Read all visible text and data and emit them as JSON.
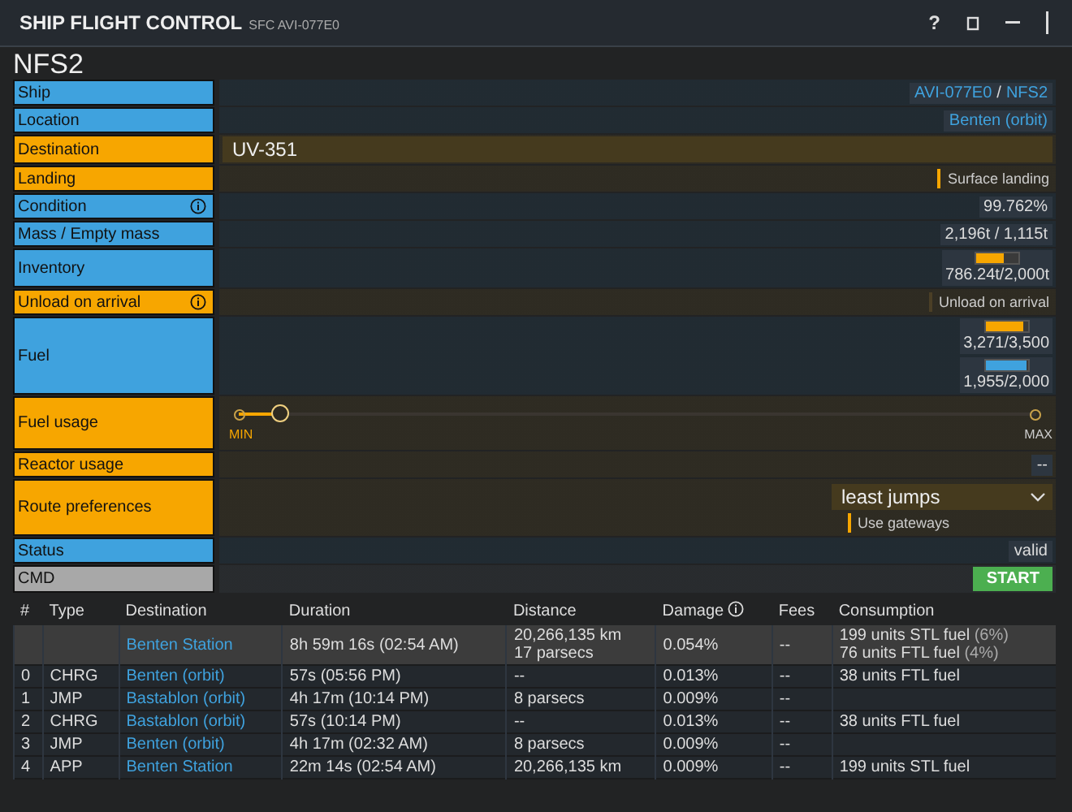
{
  "window": {
    "title": "SHIP FLIGHT CONTROL",
    "subtitle": "SFC AVI-077E0",
    "help": "?"
  },
  "form": {
    "heading": "NFS2",
    "rows": [
      {
        "label": "Ship",
        "color": "#3fa2de",
        "info": false,
        "kind": "links",
        "parts": [
          {
            "text": "AVI-077E0",
            "link": true
          },
          {
            "text": "/",
            "link": false
          },
          {
            "text": "NFS2",
            "link": true
          }
        ]
      },
      {
        "label": "Location",
        "color": "#3fa2de",
        "info": false,
        "kind": "links",
        "parts": [
          {
            "text": "Benten (orbit)",
            "link": true
          }
        ]
      },
      {
        "label": "Destination",
        "color": "#f7a600",
        "info": false,
        "kind": "input",
        "value": "UV-351"
      },
      {
        "label": "Landing",
        "color": "#f7a600",
        "info": false,
        "kind": "toggle",
        "text": "Surface landing",
        "on": true
      },
      {
        "label": "Condition",
        "color": "#3fa2de",
        "info": true,
        "kind": "text",
        "value": "99.762%"
      },
      {
        "label": "Mass / Empty mass",
        "color": "#3fa2de",
        "info": false,
        "kind": "text",
        "value": "2,196t / 1,115t"
      },
      {
        "label": "Inventory",
        "color": "#3fa2de",
        "info": false,
        "kind": "meters",
        "meters": [
          {
            "level": 0.65,
            "color": "#f7a600",
            "reading": "786.24t/2,000t"
          }
        ]
      },
      {
        "label": "Unload on arrival",
        "color": "#f7a600",
        "info": true,
        "kind": "toggle",
        "text": "Unload on arrival",
        "on": false
      },
      {
        "label": "Fuel",
        "color": "#3fa2de",
        "info": false,
        "kind": "meters",
        "meters": [
          {
            "level": 0.92,
            "color": "#f7a600",
            "reading": "3,271/3,500"
          },
          {
            "level": 0.98,
            "color": "#3fa2de",
            "reading": "1,955/2,000"
          }
        ]
      },
      {
        "label": "Fuel usage",
        "color": "#f7a600",
        "info": false,
        "kind": "slider",
        "level": 0.05,
        "min": "MIN",
        "max": "MAX"
      },
      {
        "label": "Reactor usage",
        "color": "#f7a600",
        "info": false,
        "kind": "text",
        "value": "--"
      },
      {
        "label": "Route preferences",
        "color": "#f7a600",
        "info": false,
        "kind": "dropdown",
        "value": "least jumps",
        "option": {
          "text": "Use gateways",
          "on": true
        }
      },
      {
        "label": "Status",
        "color": "#3fa2de",
        "info": false,
        "kind": "text",
        "value": "valid"
      },
      {
        "label": "CMD",
        "color": "#a8a8a8",
        "info": false,
        "kind": "button",
        "button": "START"
      }
    ]
  },
  "table": {
    "columns": [
      {
        "label": "#",
        "info": false
      },
      {
        "label": "Type",
        "info": false
      },
      {
        "label": "Destination",
        "info": false
      },
      {
        "label": "Duration",
        "info": false
      },
      {
        "label": "Distance",
        "info": false
      },
      {
        "label": "Damage",
        "info": true
      },
      {
        "label": "Fees",
        "info": false
      },
      {
        "label": "Consumption",
        "info": false
      }
    ],
    "rows": [
      {
        "selected": true,
        "number": "",
        "type": "",
        "destination": "Benten Station",
        "duration": "8h 59m 16s (02:54 AM)",
        "distance": [
          "20,266,135 km",
          "17 parsecs"
        ],
        "damage": "0.054%",
        "fees": "--",
        "consumption": [
          {
            "text": "199 units STL fuel",
            "note": "(6%)"
          },
          {
            "text": "76 units FTL fuel",
            "note": "(4%)"
          }
        ]
      },
      {
        "selected": false,
        "number": "0",
        "type": "CHRG",
        "destination": "Benten (orbit)",
        "duration": "57s (05:56 PM)",
        "distance": [
          "--"
        ],
        "damage": "0.013%",
        "fees": "--",
        "consumption": [
          {
            "text": "38 units FTL fuel"
          }
        ]
      },
      {
        "selected": false,
        "number": "1",
        "type": "JMP",
        "destination": "Bastablon (orbit)",
        "duration": "4h 17m (10:14 PM)",
        "distance": [
          "8 parsecs"
        ],
        "damage": "0.009%",
        "fees": "--",
        "consumption": []
      },
      {
        "selected": false,
        "number": "2",
        "type": "CHRG",
        "destination": "Bastablon (orbit)",
        "duration": "57s (10:14 PM)",
        "distance": [
          "--"
        ],
        "damage": "0.013%",
        "fees": "--",
        "consumption": [
          {
            "text": "38 units FTL fuel"
          }
        ]
      },
      {
        "selected": false,
        "number": "3",
        "type": "JMP",
        "destination": "Benten (orbit)",
        "duration": "4h 17m (02:32 AM)",
        "distance": [
          "8 parsecs"
        ],
        "damage": "0.009%",
        "fees": "--",
        "consumption": []
      },
      {
        "selected": false,
        "number": "4",
        "type": "APP",
        "destination": "Benten Station",
        "duration": "22m 14s (02:54 AM)",
        "distance": [
          "20,266,135 km"
        ],
        "damage": "0.009%",
        "fees": "--",
        "consumption": [
          {
            "text": "199 units STL fuel"
          }
        ]
      }
    ]
  }
}
